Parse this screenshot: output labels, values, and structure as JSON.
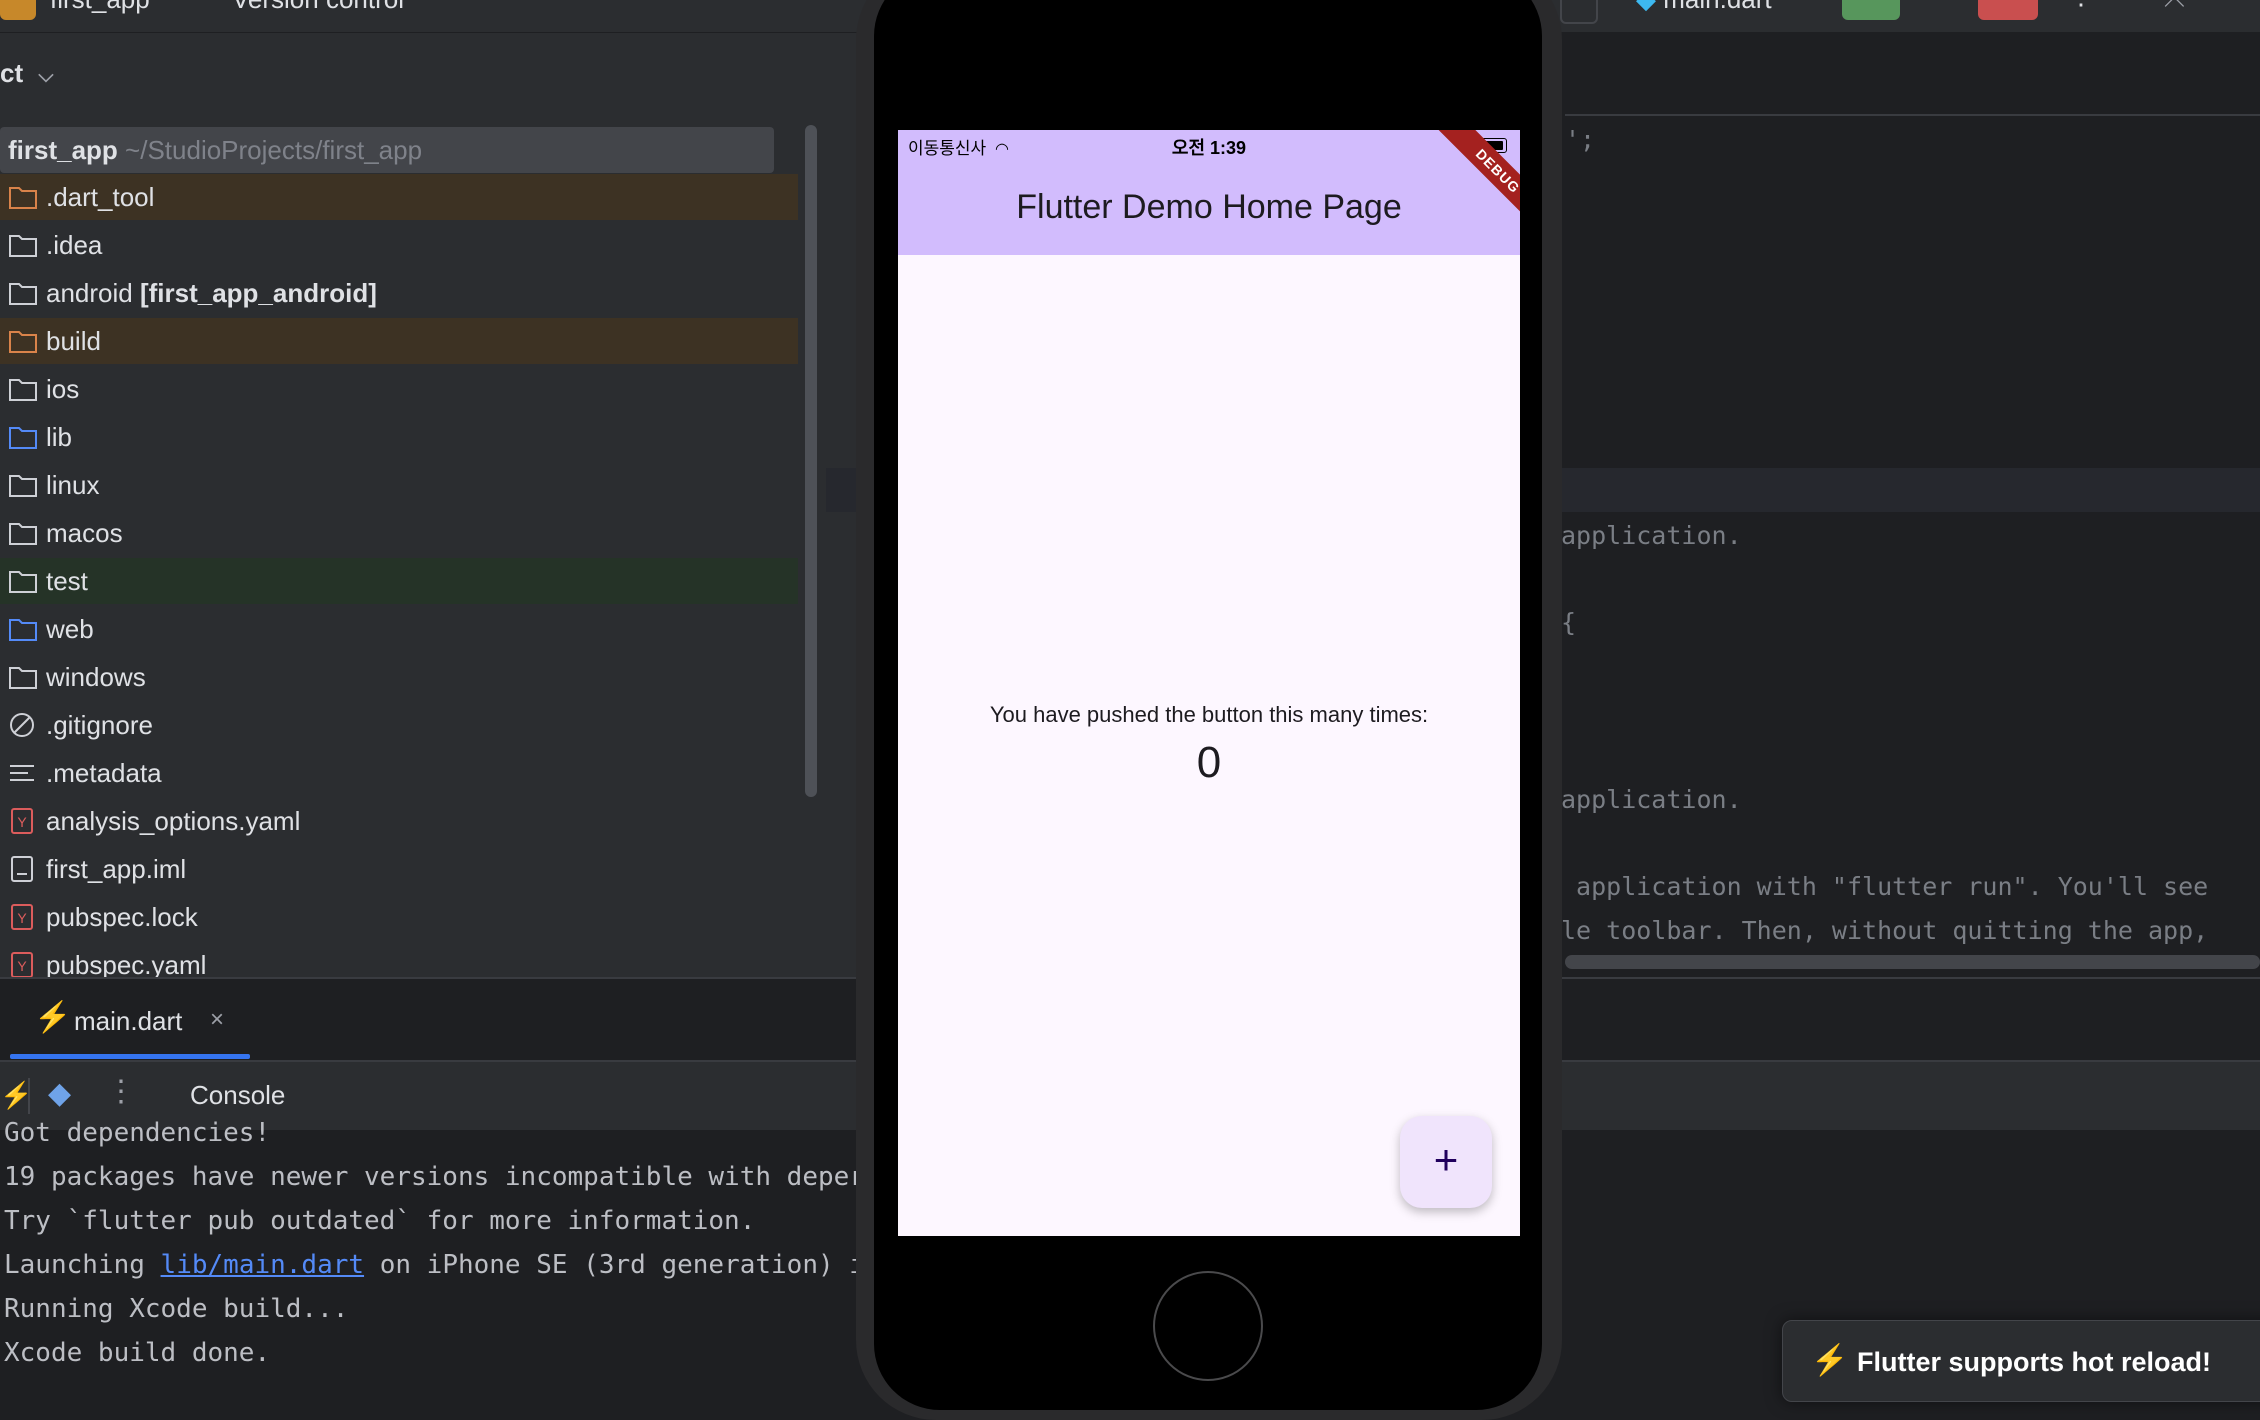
{
  "topbar": {
    "project_name": "first_app",
    "vcs": "Version control",
    "run_config": "main.dart"
  },
  "project_panel": {
    "header": "ct",
    "root": {
      "name": "first_app",
      "path": "~/StudioProjects/first_app"
    },
    "items": [
      {
        "label": ".dart_tool",
        "icon": "folder-excluded-icon"
      },
      {
        "label": ".idea",
        "icon": "folder-config-icon"
      },
      {
        "label": "android",
        "bold_suffix": "[first_app_android]",
        "icon": "folder-icon"
      },
      {
        "label": "build",
        "icon": "folder-excluded-icon"
      },
      {
        "label": "ios",
        "icon": "folder-icon"
      },
      {
        "label": "lib",
        "icon": "folder-source-icon"
      },
      {
        "label": "linux",
        "icon": "folder-icon"
      },
      {
        "label": "macos",
        "icon": "folder-icon"
      },
      {
        "label": "test",
        "icon": "folder-test-icon"
      },
      {
        "label": "web",
        "icon": "folder-web-icon"
      },
      {
        "label": "windows",
        "icon": "folder-icon"
      },
      {
        "label": ".gitignore",
        "icon": "ignore-file-icon"
      },
      {
        "label": ".metadata",
        "icon": "text-file-icon"
      },
      {
        "label": "analysis_options.yaml",
        "icon": "yaml-file-icon"
      },
      {
        "label": "first_app.iml",
        "icon": "iml-file-icon"
      },
      {
        "label": "pubspec.lock",
        "icon": "yaml-file-icon"
      },
      {
        "label": "pubspec.yaml",
        "icon": "yaml-file-icon"
      }
    ]
  },
  "editor": {
    "lines": [
      "';",
      "application.",
      "{",
      "application.",
      " application with \"flutter run\". You'll see",
      "le toolbar. Then, without quitting the app,"
    ]
  },
  "bottom": {
    "tab_label": "main.dart",
    "console_label": "Console",
    "console_lines": [
      "Got dependencies!",
      "19 packages have newer versions incompatible with deper",
      "Try `flutter pub outdated` for more information.",
      "Running Xcode build...",
      "Xcode build done."
    ],
    "launch_line": {
      "prefix": "Launching ",
      "link": "lib/main.dart",
      "suffix": " on iPhone SE (3rd generation) i"
    }
  },
  "notification": {
    "text": "Flutter supports hot reload!"
  },
  "simulator": {
    "carrier": "이동통신사",
    "time": "오전 1:39",
    "debug_banner": "DEBUG",
    "app_title": "Flutter Demo Home Page",
    "counter_text": "You have pushed the button this many times:",
    "counter_value": "0",
    "fab_label": "+"
  },
  "colors": {
    "accent": "#3574f0",
    "app_bar": "#d2bcfd",
    "run_button": "#57965c",
    "stop_button": "#c94f4f",
    "excluded_row": "#3d3223",
    "test_row": "#253327"
  }
}
